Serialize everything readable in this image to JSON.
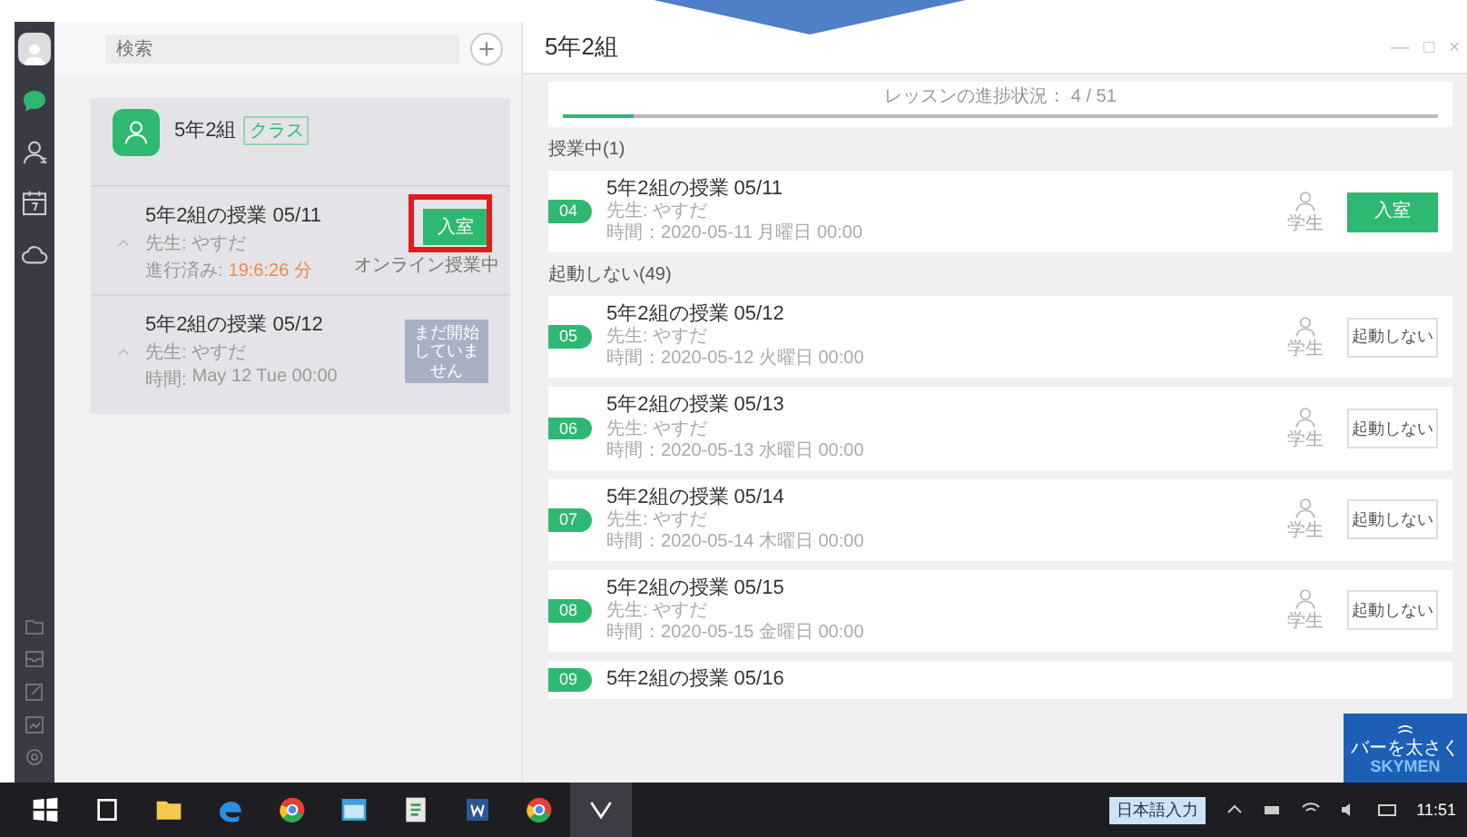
{
  "rail": {
    "items": [
      {
        "kind": "chat",
        "selected": true
      },
      {
        "kind": "contacts",
        "selected": false
      },
      {
        "kind": "calendar",
        "selected": false
      },
      {
        "kind": "cloud",
        "selected": false
      }
    ],
    "bottom_items": [
      {
        "kind": "folder"
      },
      {
        "kind": "inbox"
      },
      {
        "kind": "edit"
      },
      {
        "kind": "chart"
      },
      {
        "kind": "settings"
      }
    ]
  },
  "sidebar": {
    "search": {
      "placeholder": "検索"
    },
    "group": {
      "name": "5年2組",
      "tag": "クラス"
    },
    "sessions": [
      {
        "title": "5年2組の授業 05/11",
        "teacher": "先生: やすだ",
        "time_label": "進行済み:",
        "time": "19:6:26 分",
        "action": {
          "kind": "enter",
          "label": "入室"
        },
        "note": "オンライン授業中",
        "highlighted": true
      },
      {
        "title": "5年2組の授業 05/12",
        "teacher": "先生: やすだ",
        "time_label": "時間:",
        "time": "May 12 Tue 00:00",
        "action": {
          "kind": "pending",
          "label": "まだ開始していません"
        },
        "highlighted": false
      }
    ]
  },
  "main": {
    "title": "5年2組",
    "window_controls": [
      "—",
      "□",
      "×"
    ],
    "progress": {
      "label": "レッスンの進捗状況： 4 / 51",
      "level": 0.08
    },
    "sections": [
      {
        "heading": "授業中(1)",
        "lessons": [
          {
            "badge": "04",
            "title": "5年2組の授業 05/11",
            "teacher": "先生: やすだ",
            "time": "時間：2020-05-11 月曜日 00:00",
            "student": "学生",
            "action": {
              "kind": "enter",
              "label": "入室"
            }
          }
        ]
      },
      {
        "heading": "起動しない(49)",
        "lessons": [
          {
            "badge": "05",
            "title": "5年2組の授業 05/12",
            "teacher": "先生: やすだ",
            "time": "時間：2020-05-12 火曜日 00:00",
            "student": "学生",
            "action": {
              "kind": "idle",
              "label": "起動しない"
            }
          },
          {
            "badge": "06",
            "title": "5年2組の授業 05/13",
            "teacher": "先生: やすだ",
            "time": "時間：2020-05-13 水曜日 00:00",
            "student": "学生",
            "action": {
              "kind": "idle",
              "label": "起動しない"
            }
          },
          {
            "badge": "07",
            "title": "5年2組の授業 05/14",
            "teacher": "先生: やすだ",
            "time": "時間：2020-05-14 木曜日 00:00",
            "student": "学生",
            "action": {
              "kind": "idle",
              "label": "起動しない"
            }
          },
          {
            "badge": "08",
            "title": "5年2組の授業 05/15",
            "teacher": "先生: やすだ",
            "time": "時間：2020-05-15 金曜日 00:00",
            "student": "学生",
            "action": {
              "kind": "idle",
              "label": "起動しない"
            }
          },
          {
            "badge": "09",
            "title": "5年2組の授業 05/16"
          }
        ]
      }
    ]
  },
  "popup": {
    "lines": [
      "バーを太さく",
      "SKYMEN"
    ]
  },
  "taskbar": {
    "apps": [
      {
        "kind": "start"
      },
      {
        "kind": "taskview"
      },
      {
        "kind": "folder"
      },
      {
        "kind": "edge"
      },
      {
        "kind": "chrome"
      },
      {
        "kind": "window"
      },
      {
        "kind": "doc"
      },
      {
        "kind": "word"
      },
      {
        "kind": "chrome"
      },
      {
        "kind": "app",
        "selected": true
      }
    ],
    "ime": "日本語入力",
    "clock": "11:51"
  }
}
